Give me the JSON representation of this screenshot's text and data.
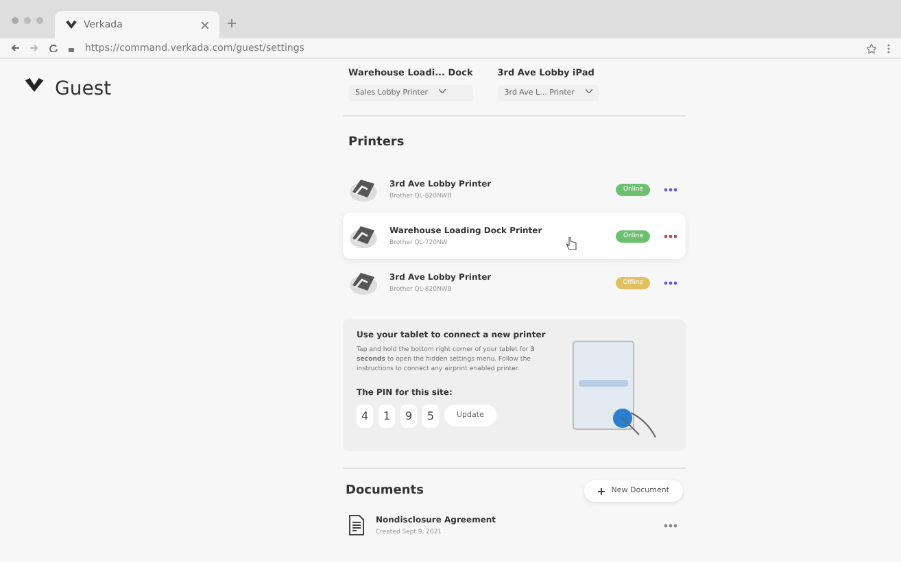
{
  "browser": {
    "tab_title": "Verkada",
    "url": "https://command.verkada.com/guest/settings"
  },
  "sidebar": {
    "title": "Guest"
  },
  "lobby_devices": [
    {
      "label": "Warehouse Loadi... Dock",
      "select": "Sales Lobby Printer"
    },
    {
      "label": "3rd Ave Lobby iPad",
      "select": "3rd Ave L... Printer"
    }
  ],
  "printers": {
    "title": "Printers",
    "items": [
      {
        "name": "3rd Ave Lobby Printer",
        "model": "Brother QL-820NWB",
        "status": "Online",
        "kind": "online",
        "hovered": false
      },
      {
        "name": "Warehouse Loading Dock Printer",
        "model": "Brother QL-720NW",
        "status": "Online",
        "kind": "online",
        "hovered": true
      },
      {
        "name": "3rd Ave Lobby Printer",
        "model": "Brother QL-820NWB",
        "status": "Offline",
        "kind": "offline",
        "hovered": false
      }
    ]
  },
  "tablet_card": {
    "title": "Use your tablet to connect a new printer",
    "body": "Tap and hold the bottom right corner of your tablet for **3 seconds** to open the hidden settings menu. Follow the instructions to connect any airprint enabled printer.",
    "pin_label": "The PIN for this site:",
    "pin": [
      "4",
      "1",
      "9",
      "5"
    ],
    "update_button": "Update"
  },
  "documents": {
    "title": "Documents",
    "new_button": "New Document",
    "items": [
      {
        "name": "Nondisclosure Agreement",
        "created": "Created Sept 9, 2021"
      }
    ]
  }
}
